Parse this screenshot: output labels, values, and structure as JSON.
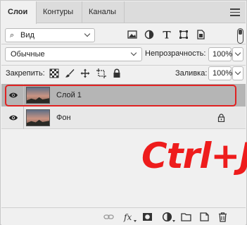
{
  "tabs": [
    {
      "label": "Слои",
      "active": true
    },
    {
      "label": "Контуры",
      "active": false
    },
    {
      "label": "Каналы",
      "active": false
    }
  ],
  "filter": {
    "label": "Вид",
    "icons": [
      "image-filter-icon",
      "adjustment-filter-icon",
      "type-filter-icon",
      "shape-filter-icon",
      "smart-object-filter-icon"
    ]
  },
  "blend": {
    "mode": "Обычные",
    "opacity_label": "Непрозрачность:",
    "opacity_value": "100%"
  },
  "lock": {
    "label": "Закрепить:",
    "fill_label": "Заливка:",
    "fill_value": "100%"
  },
  "layers": [
    {
      "name": "Слой 1",
      "visible": true,
      "selected": true
    },
    {
      "name": "Фон",
      "visible": true,
      "selected": false,
      "locked": true
    }
  ],
  "annotation": {
    "shortcut": "Ctrl+J",
    "color": "#ee1c1c"
  },
  "colors": {
    "selection_ring": "#e02222",
    "selected_layer_bg": "#b5b5b5"
  }
}
